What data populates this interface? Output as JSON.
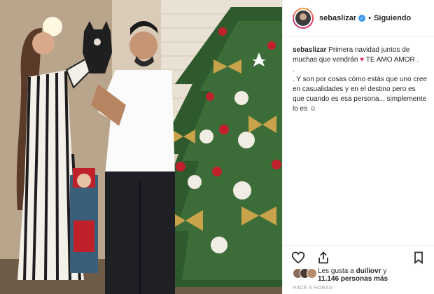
{
  "header": {
    "username": "sebaslizar",
    "separator": "•",
    "follow_label": "Siguiendo",
    "verified_icon": "verified-badge-icon"
  },
  "caption": {
    "username": "sebaslizar",
    "line1_a": "Primera navidad juntos de muchas que vendrán",
    "line1_heart": "♥",
    "line1_b": "TE AMO AMOR .",
    "line2": ".",
    "line3": ". Y son por cosas cómo estás que uno cree en casualidades y en el destino pero es que cuando es esa persona... simplemente lo es ☺"
  },
  "actions": {
    "like_icon": "heart-outline-icon",
    "share_icon": "share-icon",
    "save_icon": "bookmark-icon"
  },
  "likes": {
    "prefix": "Les gusta a",
    "user": "duiliovr",
    "middle": "y",
    "count": "11.146 personas más"
  },
  "timestamp": "HACE 8 HORAS",
  "colors": {
    "accent": "#3897f0",
    "heart": "#e0245e",
    "border": "#efefef"
  }
}
